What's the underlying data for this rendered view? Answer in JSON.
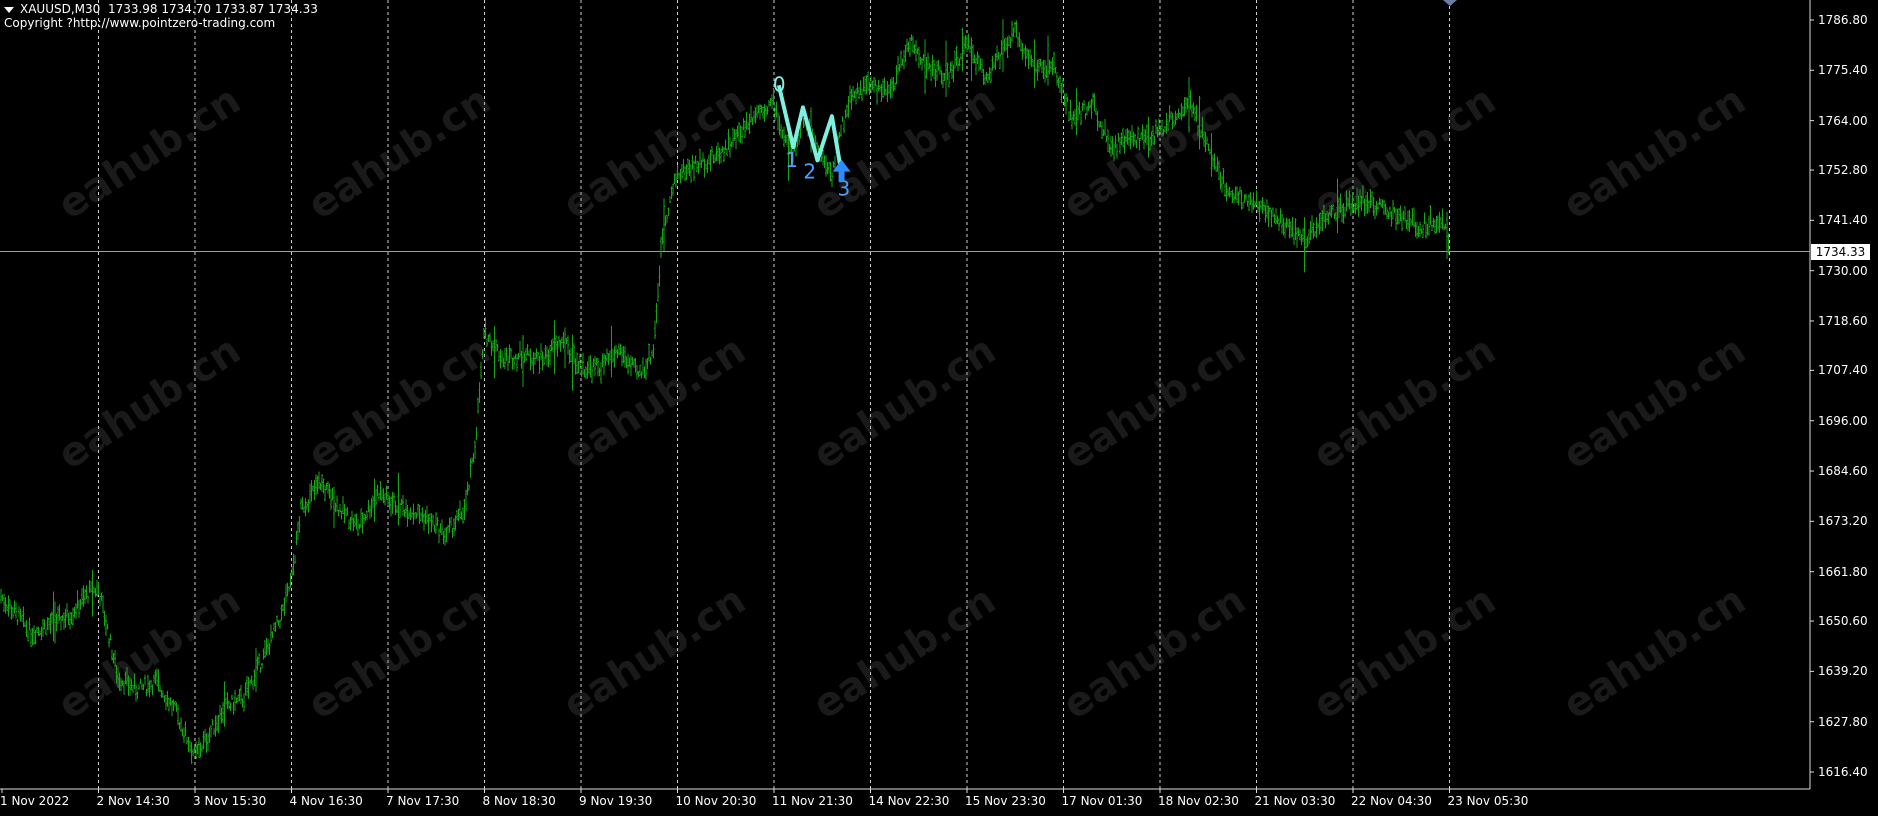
{
  "header": {
    "symbol": "XAUUSD,M30",
    "ohlc": "1733.98 1734.70 1733.87 1734.33",
    "copyright": "Copyright ?http://www.pointzero-trading.com"
  },
  "watermark_text": "eahub.cn",
  "colors": {
    "background": "#000000",
    "bars": "#16a516",
    "grid": "#cfcfcf",
    "pattern": "#7ff0e0",
    "pattern_label": "#4aa3ff",
    "arrow": "#2f8cff"
  },
  "chart_data": {
    "type": "line",
    "style": "bar-ohlc",
    "symbol": "XAUUSD",
    "timeframe": "M30",
    "current_price": 1734.33,
    "current_price_label": "1734.33",
    "ylim": [
      1612.0,
      1794.0
    ],
    "y_ticks": [
      "1786.80",
      "1775.40",
      "1764.00",
      "1752.80",
      "1741.40",
      "1730.00",
      "1718.60",
      "1707.40",
      "1696.00",
      "1684.60",
      "1673.20",
      "1661.80",
      "1650.60",
      "1639.20",
      "1627.80",
      "1616.40"
    ],
    "x_ticks": [
      "1 Nov 2022",
      "2 Nov 14:30",
      "3 Nov 15:30",
      "4 Nov 16:30",
      "7 Nov 17:30",
      "8 Nov 18:30",
      "9 Nov 19:30",
      "10 Nov 20:30",
      "11 Nov 21:30",
      "14 Nov 22:30",
      "15 Nov 23:30",
      "17 Nov 01:30",
      "18 Nov 02:30",
      "21 Nov 03:30",
      "22 Nov 04:30",
      "23 Nov 05:30"
    ],
    "grid": "vertical-dashed",
    "price_path": [
      [
        0,
        1656
      ],
      [
        0.15,
        1652
      ],
      [
        0.3,
        1648
      ],
      [
        0.5,
        1650
      ],
      [
        0.7,
        1652
      ],
      [
        0.9,
        1657
      ],
      [
        1.0,
        1658
      ],
      [
        1.1,
        1648
      ],
      [
        1.2,
        1638
      ],
      [
        1.4,
        1635
      ],
      [
        1.6,
        1637
      ],
      [
        1.8,
        1630
      ],
      [
        2.0,
        1620
      ],
      [
        2.15,
        1625
      ],
      [
        2.3,
        1631
      ],
      [
        2.5,
        1633
      ],
      [
        2.7,
        1642
      ],
      [
        2.9,
        1652
      ],
      [
        3.0,
        1660
      ],
      [
        3.1,
        1676
      ],
      [
        3.3,
        1682
      ],
      [
        3.5,
        1676
      ],
      [
        3.7,
        1672
      ],
      [
        3.9,
        1680
      ],
      [
        4.0,
        1678
      ],
      [
        4.2,
        1676
      ],
      [
        4.4,
        1674
      ],
      [
        4.6,
        1670
      ],
      [
        4.8,
        1676
      ],
      [
        4.9,
        1690
      ],
      [
        5.0,
        1716
      ],
      [
        5.2,
        1710
      ],
      [
        5.4,
        1711
      ],
      [
        5.6,
        1710
      ],
      [
        5.8,
        1714
      ],
      [
        6.0,
        1708
      ],
      [
        6.2,
        1708
      ],
      [
        6.4,
        1712
      ],
      [
        6.6,
        1706
      ],
      [
        6.75,
        1712
      ],
      [
        6.85,
        1740
      ],
      [
        7.0,
        1752
      ],
      [
        7.2,
        1754
      ],
      [
        7.4,
        1756
      ],
      [
        7.6,
        1760
      ],
      [
        7.8,
        1766
      ],
      [
        8.0,
        1768
      ],
      [
        8.1,
        1760
      ],
      [
        8.2,
        1756
      ],
      [
        8.3,
        1765
      ],
      [
        8.45,
        1758
      ],
      [
        8.6,
        1752
      ],
      [
        8.7,
        1762
      ],
      [
        8.8,
        1770
      ],
      [
        9.0,
        1772
      ],
      [
        9.2,
        1770
      ],
      [
        9.4,
        1782
      ],
      [
        9.6,
        1776
      ],
      [
        9.8,
        1774
      ],
      [
        10.0,
        1781
      ],
      [
        10.2,
        1774
      ],
      [
        10.5,
        1784
      ],
      [
        10.7,
        1776
      ],
      [
        10.9,
        1776
      ],
      [
        11.1,
        1764
      ],
      [
        11.3,
        1768
      ],
      [
        11.5,
        1758
      ],
      [
        11.7,
        1760
      ],
      [
        11.9,
        1760
      ],
      [
        12.1,
        1764
      ],
      [
        12.3,
        1768
      ],
      [
        12.5,
        1758
      ],
      [
        12.7,
        1748
      ],
      [
        12.9,
        1746
      ],
      [
        13.1,
        1744
      ],
      [
        13.3,
        1740
      ],
      [
        13.5,
        1737
      ],
      [
        13.7,
        1742
      ],
      [
        13.9,
        1744
      ],
      [
        14.1,
        1746
      ],
      [
        14.3,
        1744
      ],
      [
        14.5,
        1742
      ],
      [
        14.7,
        1740
      ],
      [
        14.9,
        1742
      ],
      [
        15.0,
        1736
      ]
    ],
    "pattern": {
      "points": [
        [
          8.05,
          1772
        ],
        [
          8.2,
          1758
        ],
        [
          8.3,
          1767
        ],
        [
          8.45,
          1755
        ],
        [
          8.6,
          1765
        ],
        [
          8.7,
          1752
        ]
      ],
      "labels": [
        "0",
        "1",
        "2",
        "3"
      ],
      "arrow": "up"
    }
  }
}
